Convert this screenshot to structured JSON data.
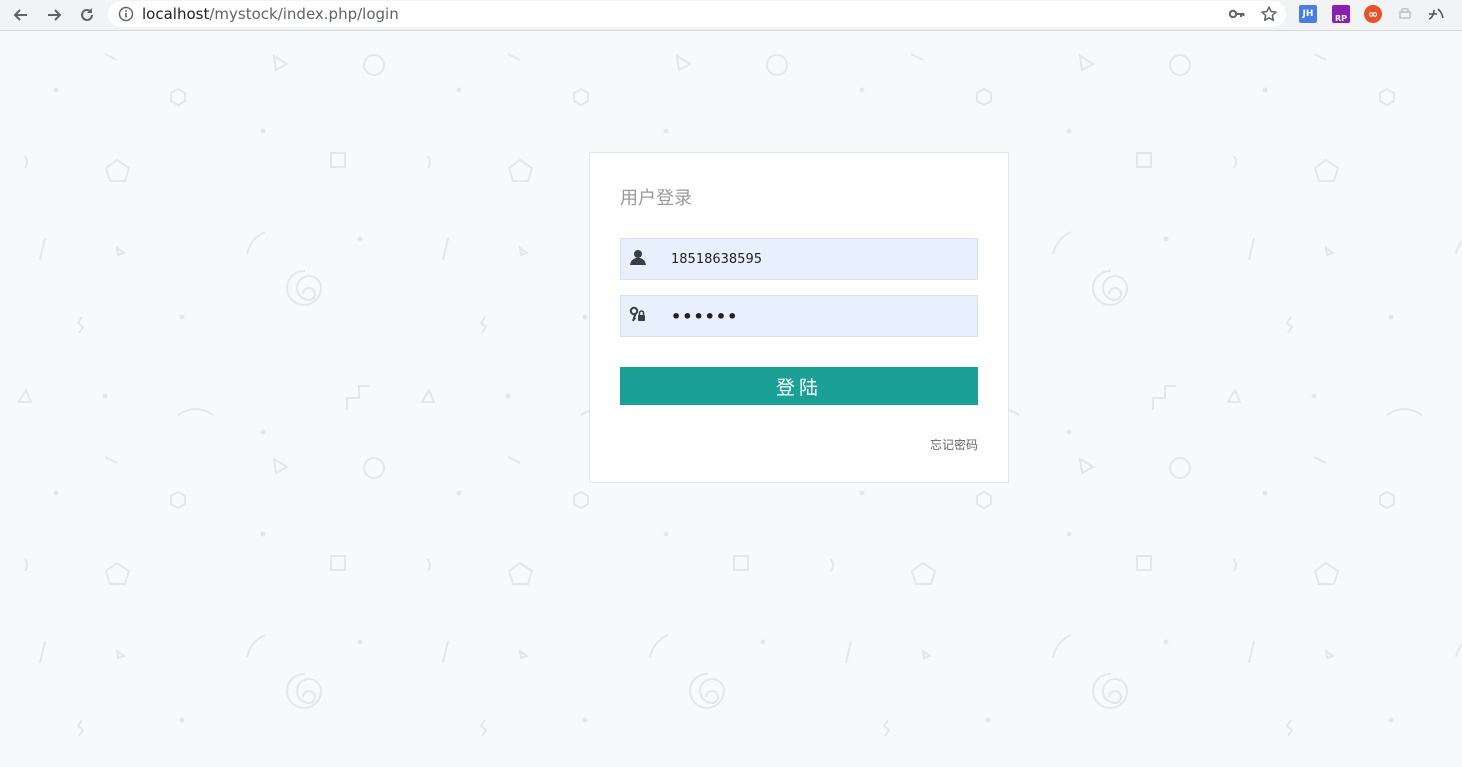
{
  "browser": {
    "url_host": "localhost",
    "url_path": "/mystock/index.php/login",
    "extensions": [
      {
        "name": "jh-extension-icon",
        "label": "JH",
        "color": "#4a7de2"
      },
      {
        "name": "rp-extension-icon",
        "label": "RP",
        "color": "#8a1fb5"
      },
      {
        "name": "loop-extension-icon",
        "label": "∞",
        "color": "#e8522a"
      }
    ]
  },
  "login": {
    "title": "用户登录",
    "username_value": "18518638595",
    "password_value": "111111",
    "submit_label": "登陆",
    "forgot_label": "忘记密码"
  },
  "colors": {
    "accent": "#1aa094",
    "field_bg": "#e8f0fe",
    "page_bg": "#f8f9fb"
  }
}
